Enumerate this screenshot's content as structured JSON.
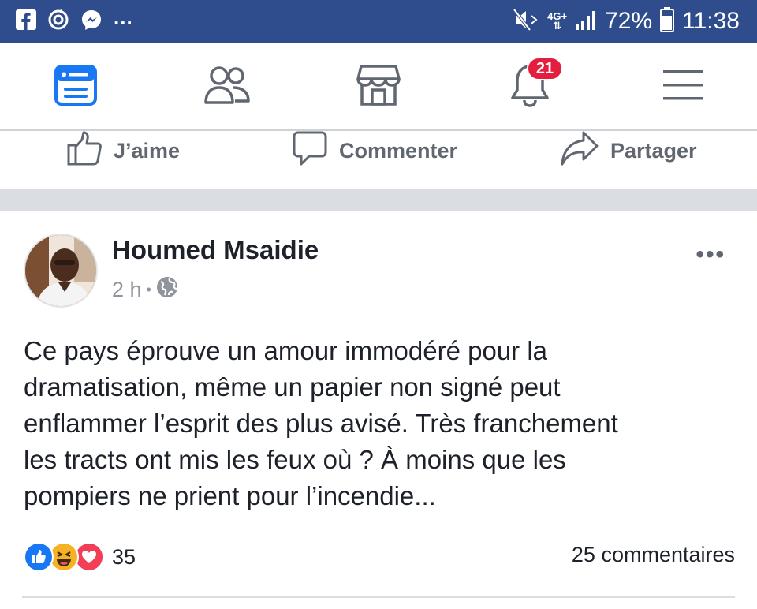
{
  "status_bar": {
    "left_icons": [
      "facebook-icon",
      "sync-icon",
      "messenger-icon"
    ],
    "more_dots": "...",
    "network_type": "4G+",
    "battery_percent": "72%",
    "time": "11:38",
    "bg_color": "#2f4c8c"
  },
  "top_nav": {
    "items": [
      {
        "name": "news-feed-icon",
        "active": true
      },
      {
        "name": "friends-icon",
        "active": false
      },
      {
        "name": "marketplace-icon",
        "active": false
      },
      {
        "name": "notifications-icon",
        "active": false
      },
      {
        "name": "menu-icon",
        "active": false
      }
    ],
    "notifications_badge": "21",
    "active_color": "#1877f2",
    "badge_color": "#e41e3f"
  },
  "action_bar": {
    "like_label": "J’aime",
    "comment_label": "Commenter",
    "share_label": "Partager"
  },
  "post": {
    "author": "Houmed Msaidie",
    "time": "2 h",
    "separator": "•",
    "audience_icon": "globe-icon",
    "more_icon": "•••",
    "text": "Ce pays éprouve un amour immodéré pour la\ndramatisation, même un papier non signé peut\nenflammer l’esprit des plus avisé. Très franchement\nles tracts ont mis les feux où ? À moins que les\npompiers ne prient pour l’incendie...",
    "reactions": [
      "like-reaction-icon",
      "haha-reaction-icon",
      "love-reaction-icon"
    ],
    "reaction_count": "35",
    "comments_count": "25 commentaires"
  }
}
